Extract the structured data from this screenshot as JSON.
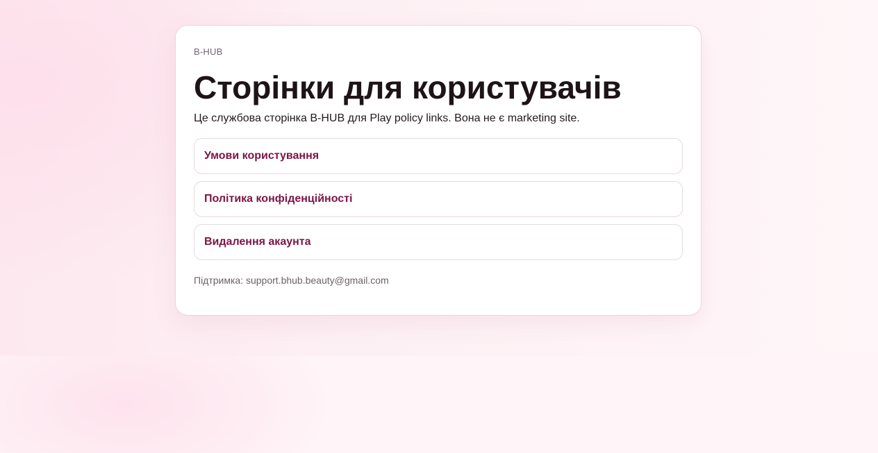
{
  "brand": "B-HUB",
  "title": "Сторінки для користувачів",
  "subtitle": "Це службова сторінка B-HUB для Play policy links. Вона не є marketing site.",
  "links": [
    {
      "label": "Умови користування"
    },
    {
      "label": "Політика конфіденційності"
    },
    {
      "label": "Видалення акаунта"
    }
  ],
  "support": "Підтримка: support.bhub.beauty@gmail.com",
  "colors": {
    "accent": "#7d1446",
    "title": "#1e1418",
    "muted": "#6b6168",
    "background": "#fff6f9"
  }
}
